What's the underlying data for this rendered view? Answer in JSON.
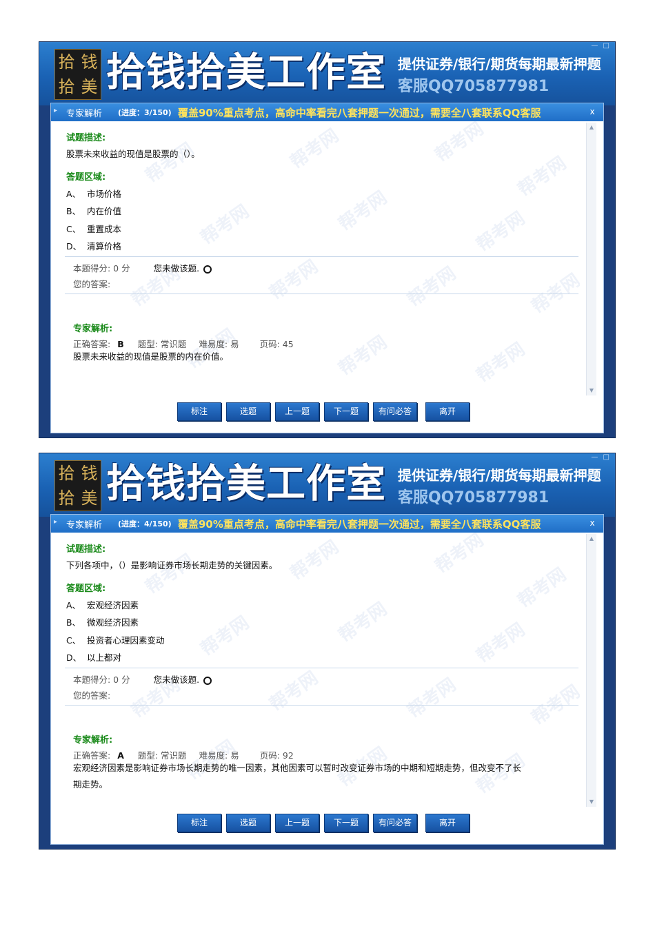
{
  "banner": {
    "logo_chars": [
      "拾",
      "钱",
      "拾",
      "美"
    ],
    "studio_name": "拾钱拾美工作室",
    "promo_line1": "提供证券/银行/期货每期最新押题",
    "promo_line2": "客服QQ705877981",
    "window_dots": "— □"
  },
  "panels": [
    {
      "titlebar": {
        "name": "专家解析",
        "progress": "(进度：3/150)",
        "marquee": "覆盖90%重点考点，高命中率看完八套押题一次通过，需要全八套联系QQ客服",
        "close": "x",
        "arrow": "▸"
      },
      "question_heading": "试题描述:",
      "question": "股票未来收益的现值是股票的（）。",
      "answer_heading": "答题区域:",
      "options": [
        {
          "key": "A、",
          "text": "市场价格"
        },
        {
          "key": "B、",
          "text": "内在价值"
        },
        {
          "key": "C、",
          "text": "重置成本"
        },
        {
          "key": "D、",
          "text": "清算价格"
        }
      ],
      "score_label": "本题得分: 0 分",
      "not_done": "您未做该题.",
      "your_answer_label": "您的答案:",
      "analysis_heading": "专家解析:",
      "correct_label": "正确答案:",
      "correct_value": "B",
      "type_label": "题型: 常识题",
      "difficulty_label": "难易度: 易",
      "page_label": "页码: 45",
      "explanation": "股票未来收益的现值是股票的内在价值。"
    },
    {
      "titlebar": {
        "name": "专家解析",
        "progress": "(进度：4/150)",
        "marquee": "覆盖90%重点考点，高命中率看完八套押题一次通过，需要全八套联系QQ客服",
        "close": "x",
        "arrow": "▸"
      },
      "question_heading": "试题描述:",
      "question": "下列各项中，（）是影响证券市场长期走势的关键因素。",
      "answer_heading": "答题区域:",
      "options": [
        {
          "key": "A、",
          "text": "宏观经济因素"
        },
        {
          "key": "B、",
          "text": "微观经济因素"
        },
        {
          "key": "C、",
          "text": "投资者心理因素变动"
        },
        {
          "key": "D、",
          "text": "以上都对"
        }
      ],
      "score_label": "本题得分: 0 分",
      "not_done": "您未做该题.",
      "your_answer_label": "您的答案:",
      "analysis_heading": "专家解析:",
      "correct_label": "正确答案:",
      "correct_value": "A",
      "type_label": "题型: 常识题",
      "difficulty_label": "难易度: 易",
      "page_label": "页码: 92",
      "explanation_line1": "宏观经济因素是影响证券市场长期走势的唯一因素，其他因素可以暂时改变证券市场的中期和短期走势，但改变不了长",
      "explanation_line2": "期走势。"
    }
  ],
  "buttons": {
    "mark": "标注",
    "select": "选题",
    "prev": "上一题",
    "next": "下一题",
    "faq": "有问必答",
    "leave": "离开"
  },
  "watermark": "帮考网",
  "colors": {
    "banner_blue": "#1a62b4",
    "section_green": "#1a8a1a",
    "marquee_yellow": "#ffe35c",
    "button_blue": "#1651a1"
  }
}
